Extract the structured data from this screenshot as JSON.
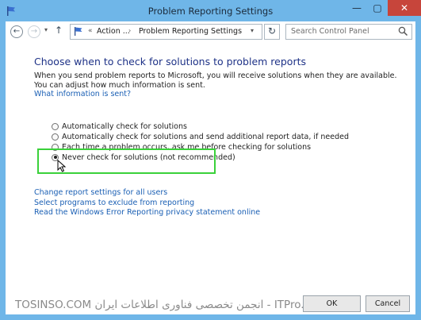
{
  "window": {
    "title": "Problem Reporting Settings",
    "minimize": "—",
    "maximize": "▢",
    "close": "✕"
  },
  "navbar": {
    "back_glyph": "←",
    "forward_glyph": "→",
    "history_glyph": "▾",
    "up_glyph": "↑",
    "address": {
      "overflow": "«",
      "segment1": "Action ...",
      "separator": "›",
      "segment2": "Problem Reporting Settings",
      "dropdown": "▾"
    },
    "refresh_glyph": "↻",
    "search_placeholder": "Search Control Panel"
  },
  "content": {
    "heading": "Choose when to check for solutions to problem reports",
    "description": "When you send problem reports to Microsoft, you will receive solutions when they are available. You can adjust how much information is sent.",
    "what_link": "What information is sent?",
    "options": [
      {
        "label": "Automatically check for solutions",
        "checked": false
      },
      {
        "label": "Automatically check for solutions and send additional report data, if needed",
        "checked": false
      },
      {
        "label": "Each time a problem occurs, ask me before checking for solutions",
        "checked": false
      },
      {
        "label": "Never check for solutions (not recommended)",
        "checked": true
      }
    ],
    "links": [
      "Change report settings for all users",
      "Select programs to exclude from reporting",
      "Read the Windows Error Reporting privacy statement online"
    ]
  },
  "footer": {
    "watermark": "TOSINSO.COM انجمن تخصصی فناوری اطلاعات ایران - ITPro.ir",
    "ok_label": "OK",
    "cancel_label": "Cancel"
  },
  "colors": {
    "frame": "#6fb6e8",
    "heading": "#1e3287",
    "link": "#1a5fb4",
    "highlight": "#3ad13a",
    "close": "#c7453b"
  }
}
